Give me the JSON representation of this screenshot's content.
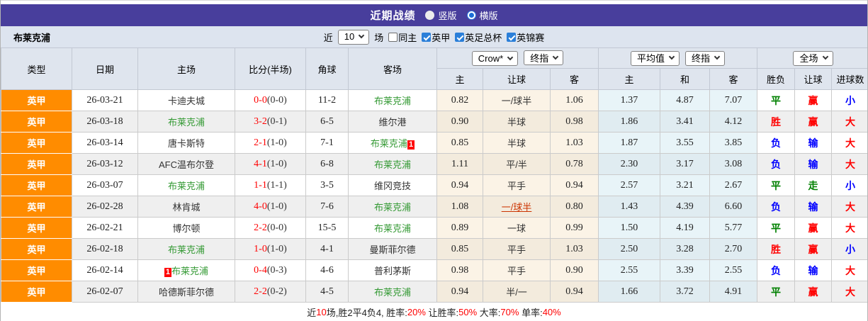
{
  "colors": {
    "purple": "#483e9c",
    "orange": "#ff8c00",
    "team_green": "#339933",
    "red": "#ff0000",
    "blue": "#0000ff",
    "result_green": "#008000",
    "changed_handicap_red": "#cc3300"
  },
  "title_bar": {
    "title": "近期战绩",
    "vertical_label": "竖版",
    "vertical_checked": false,
    "horizontal_label": "横版",
    "horizontal_checked": true
  },
  "filter_bar": {
    "team": "布莱克浦",
    "near_label": "近",
    "rounds_value": "10",
    "rounds_suffix": "场",
    "checkboxes": [
      {
        "label": "同主",
        "checked": false
      },
      {
        "label": "英甲",
        "checked": true
      },
      {
        "label": "英足总杯",
        "checked": true
      },
      {
        "label": "英锦赛",
        "checked": true
      }
    ]
  },
  "table": {
    "columns": [
      "类型",
      "日期",
      "主场",
      "比分(半场)",
      "角球",
      "客场"
    ],
    "odds_groups": [
      {
        "selects": [
          "Crow*",
          "终指"
        ],
        "sub": [
          "主",
          "让球",
          "客"
        ]
      },
      {
        "selects": [
          "平均值",
          "终指"
        ],
        "sub": [
          "主",
          "和",
          "客"
        ]
      },
      {
        "selects": [
          "全场"
        ],
        "sub": [
          "胜负",
          "让球",
          "进球数"
        ]
      }
    ],
    "rows": [
      {
        "league": "英甲",
        "date": "26-03-21",
        "home": {
          "name": "卡迪夫城",
          "highlight": false
        },
        "score": {
          "full": "0-0",
          "half": "(0-0)"
        },
        "corners": "11-2",
        "away": {
          "name": "布莱克浦",
          "highlight": true
        },
        "crow": {
          "home": "0.82",
          "handicap": "一/球半",
          "changed": false,
          "away": "1.06"
        },
        "avg": {
          "home": "1.37",
          "draw": "4.87",
          "away": "7.07"
        },
        "result": {
          "outcome": {
            "text": "平",
            "color": "green"
          },
          "handicap": {
            "text": "赢",
            "color": "red"
          },
          "goals": {
            "text": "小",
            "color": "blue"
          }
        }
      },
      {
        "league": "英甲",
        "date": "26-03-18",
        "home": {
          "name": "布莱克浦",
          "highlight": true
        },
        "score": {
          "full": "3-2",
          "half": "(0-1)"
        },
        "corners": "6-5",
        "away": {
          "name": "维尔港",
          "highlight": false
        },
        "crow": {
          "home": "0.90",
          "handicap": "半球",
          "changed": false,
          "away": "0.98"
        },
        "avg": {
          "home": "1.86",
          "draw": "3.41",
          "away": "4.12"
        },
        "result": {
          "outcome": {
            "text": "胜",
            "color": "red"
          },
          "handicap": {
            "text": "赢",
            "color": "red"
          },
          "goals": {
            "text": "大",
            "color": "red"
          }
        }
      },
      {
        "league": "英甲",
        "date": "26-03-14",
        "home": {
          "name": "唐卡斯特",
          "highlight": false
        },
        "score": {
          "full": "2-1",
          "half": "(1-0)"
        },
        "corners": "7-1",
        "away": {
          "name": "布莱克浦",
          "highlight": true,
          "badge": "1",
          "badge_pos": "after"
        },
        "crow": {
          "home": "0.85",
          "handicap": "半球",
          "changed": false,
          "away": "1.03"
        },
        "avg": {
          "home": "1.87",
          "draw": "3.55",
          "away": "3.85"
        },
        "result": {
          "outcome": {
            "text": "负",
            "color": "blue"
          },
          "handicap": {
            "text": "输",
            "color": "blue"
          },
          "goals": {
            "text": "大",
            "color": "red"
          }
        }
      },
      {
        "league": "英甲",
        "date": "26-03-12",
        "home": {
          "name": "AFC温布尔登",
          "highlight": false
        },
        "score": {
          "full": "4-1",
          "half": "(1-0)"
        },
        "corners": "6-8",
        "away": {
          "name": "布莱克浦",
          "highlight": true
        },
        "crow": {
          "home": "1.11",
          "handicap": "平/半",
          "changed": false,
          "away": "0.78"
        },
        "avg": {
          "home": "2.30",
          "draw": "3.17",
          "away": "3.08"
        },
        "result": {
          "outcome": {
            "text": "负",
            "color": "blue"
          },
          "handicap": {
            "text": "输",
            "color": "blue"
          },
          "goals": {
            "text": "大",
            "color": "red"
          }
        }
      },
      {
        "league": "英甲",
        "date": "26-03-07",
        "home": {
          "name": "布莱克浦",
          "highlight": true
        },
        "score": {
          "full": "1-1",
          "half": "(1-1)"
        },
        "corners": "3-5",
        "away": {
          "name": "维冈竞技",
          "highlight": false
        },
        "crow": {
          "home": "0.94",
          "handicap": "平手",
          "changed": false,
          "away": "0.94"
        },
        "avg": {
          "home": "2.57",
          "draw": "3.21",
          "away": "2.67"
        },
        "result": {
          "outcome": {
            "text": "平",
            "color": "green"
          },
          "handicap": {
            "text": "走",
            "color": "green"
          },
          "goals": {
            "text": "小",
            "color": "blue"
          }
        }
      },
      {
        "league": "英甲",
        "date": "26-02-28",
        "home": {
          "name": "林肯城",
          "highlight": false
        },
        "score": {
          "full": "4-0",
          "half": "(1-0)"
        },
        "corners": "7-6",
        "away": {
          "name": "布莱克浦",
          "highlight": true
        },
        "crow": {
          "home": "1.08",
          "handicap": "一/球半",
          "changed": true,
          "away": "0.80"
        },
        "avg": {
          "home": "1.43",
          "draw": "4.39",
          "away": "6.60"
        },
        "result": {
          "outcome": {
            "text": "负",
            "color": "blue"
          },
          "handicap": {
            "text": "输",
            "color": "blue"
          },
          "goals": {
            "text": "大",
            "color": "red"
          }
        }
      },
      {
        "league": "英甲",
        "date": "26-02-21",
        "home": {
          "name": "博尔顿",
          "highlight": false
        },
        "score": {
          "full": "2-2",
          "half": "(0-0)"
        },
        "corners": "15-5",
        "away": {
          "name": "布莱克浦",
          "highlight": true
        },
        "crow": {
          "home": "0.89",
          "handicap": "一球",
          "changed": false,
          "away": "0.99"
        },
        "avg": {
          "home": "1.50",
          "draw": "4.19",
          "away": "5.77"
        },
        "result": {
          "outcome": {
            "text": "平",
            "color": "green"
          },
          "handicap": {
            "text": "赢",
            "color": "red"
          },
          "goals": {
            "text": "大",
            "color": "red"
          }
        }
      },
      {
        "league": "英甲",
        "date": "26-02-18",
        "home": {
          "name": "布莱克浦",
          "highlight": true
        },
        "score": {
          "full": "1-0",
          "half": "(1-0)"
        },
        "corners": "4-1",
        "away": {
          "name": "曼斯菲尔德",
          "highlight": false
        },
        "crow": {
          "home": "0.85",
          "handicap": "平手",
          "changed": false,
          "away": "1.03"
        },
        "avg": {
          "home": "2.50",
          "draw": "3.28",
          "away": "2.70"
        },
        "result": {
          "outcome": {
            "text": "胜",
            "color": "red"
          },
          "handicap": {
            "text": "赢",
            "color": "red"
          },
          "goals": {
            "text": "小",
            "color": "blue"
          }
        }
      },
      {
        "league": "英甲",
        "date": "26-02-14",
        "home": {
          "name": "布莱克浦",
          "highlight": true,
          "badge": "1",
          "badge_pos": "before"
        },
        "score": {
          "full": "0-4",
          "half": "(0-3)"
        },
        "corners": "4-6",
        "away": {
          "name": "普利茅斯",
          "highlight": false
        },
        "crow": {
          "home": "0.98",
          "handicap": "平手",
          "changed": false,
          "away": "0.90"
        },
        "avg": {
          "home": "2.55",
          "draw": "3.39",
          "away": "2.55"
        },
        "result": {
          "outcome": {
            "text": "负",
            "color": "blue"
          },
          "handicap": {
            "text": "输",
            "color": "blue"
          },
          "goals": {
            "text": "大",
            "color": "red"
          }
        }
      },
      {
        "league": "英甲",
        "date": "26-02-07",
        "home": {
          "name": "哈德斯菲尔德",
          "highlight": false
        },
        "score": {
          "full": "2-2",
          "half": "(0-2)"
        },
        "corners": "4-5",
        "away": {
          "name": "布莱克浦",
          "highlight": true
        },
        "crow": {
          "home": "0.94",
          "handicap": "半/一",
          "changed": false,
          "away": "0.94"
        },
        "avg": {
          "home": "1.66",
          "draw": "3.72",
          "away": "4.91"
        },
        "result": {
          "outcome": {
            "text": "平",
            "color": "green"
          },
          "handicap": {
            "text": "赢",
            "color": "red"
          },
          "goals": {
            "text": "大",
            "color": "red"
          }
        }
      }
    ]
  },
  "footer": {
    "segments": [
      {
        "text": "近",
        "color": "dark"
      },
      {
        "text": "10",
        "color": "red"
      },
      {
        "text": "场,胜2平4负4, 胜率:",
        "color": "dark"
      },
      {
        "text": "20%",
        "color": "red"
      },
      {
        "text": " 让胜率:",
        "color": "dark"
      },
      {
        "text": "50%",
        "color": "red"
      },
      {
        "text": " 大率:",
        "color": "dark"
      },
      {
        "text": "70%",
        "color": "red"
      },
      {
        "text": " 单率:",
        "color": "dark"
      },
      {
        "text": "40%",
        "color": "red"
      }
    ]
  }
}
